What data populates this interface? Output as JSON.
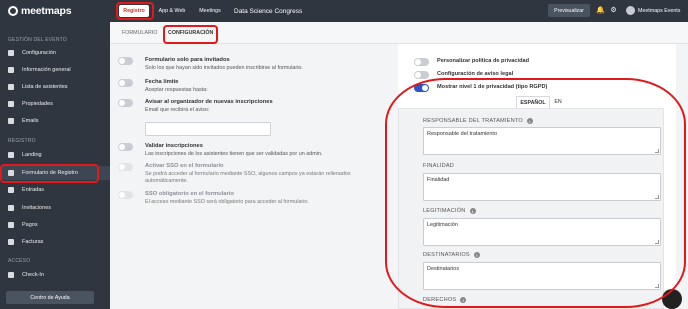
{
  "brand": {
    "logo_text": "meetmaps"
  },
  "topbar": {
    "tabs": [
      "Registro",
      "App & Web",
      "Meetings"
    ],
    "event_title": "Data Science Congress",
    "preview_label": "Previsualizar",
    "user_name": "Meetmaps Events"
  },
  "sidebar": {
    "section_event": "GESTIÓN DEL EVENTO",
    "event_items": [
      "Configuración",
      "Información general",
      "Lista de asistentes",
      "Propiedades",
      "Emails"
    ],
    "section_registro": "REGISTRO",
    "registro_items": [
      "Landing",
      "Formulario de Registro",
      "Entradas",
      "Invitaciones",
      "Pagos",
      "Facturas"
    ],
    "section_acceso": "ACCESO",
    "acceso_items": [
      "Check-In"
    ],
    "help_label": "Centro de Ayuda"
  },
  "subtabs": [
    "FORMULARIO",
    "CONFIGURACIÓN"
  ],
  "left_settings": [
    {
      "title": "Formulario solo para invitados",
      "desc": "Solo los que hayan sido invitados pueden inscribirse al formulario.",
      "enabled": false
    },
    {
      "title": "Fecha límite",
      "desc": "Aceptar respuestas hasta:",
      "enabled": false
    },
    {
      "title": "Avisar al organizador de nuevas inscripciones",
      "desc": "Email que recibirá el aviso:",
      "enabled": false
    },
    {
      "title": "Validar inscripciones",
      "desc": "Las inscripciones de los asistentes tienen que ser validadas por un admin.",
      "enabled": false
    },
    {
      "title": "Activar SSO en el formulario",
      "desc": "Se podrá acceder al formulario mediante SSO, algunos campos ya estarán rellenados",
      "desc2": "automáticamente.",
      "enabled": false
    },
    {
      "title": "SSO obligatorio en el formulario",
      "desc": "El acceso mediante SSO será obligatorio para acceder al formulario.",
      "enabled": false
    }
  ],
  "right_settings": [
    {
      "label": "Personalizar política de privacidad",
      "enabled": false
    },
    {
      "label": "Configuración de aviso legal",
      "enabled": false
    },
    {
      "label": "Mostrar nivel 1 de privacidad (tipo RGPD)",
      "enabled": true
    }
  ],
  "languages": [
    "ESPAÑOL",
    "EN"
  ],
  "privacy_fields": [
    {
      "label": "RESPONSABLE DEL TRATAMIENTO",
      "value": "Responsable del tratamiento"
    },
    {
      "label": "FINALIDAD",
      "value": "Finalidad"
    },
    {
      "label": "LEGITIMACIÓN",
      "value": "Legitimación"
    },
    {
      "label": "DESTINATARIOS",
      "value": "Destinatarios"
    },
    {
      "label": "DERECHOS",
      "value": ""
    }
  ],
  "colors": {
    "annotation_red": "#e01a1a",
    "toggle_on": "#2a54c8",
    "sidebar_bg": "#2f3640"
  }
}
